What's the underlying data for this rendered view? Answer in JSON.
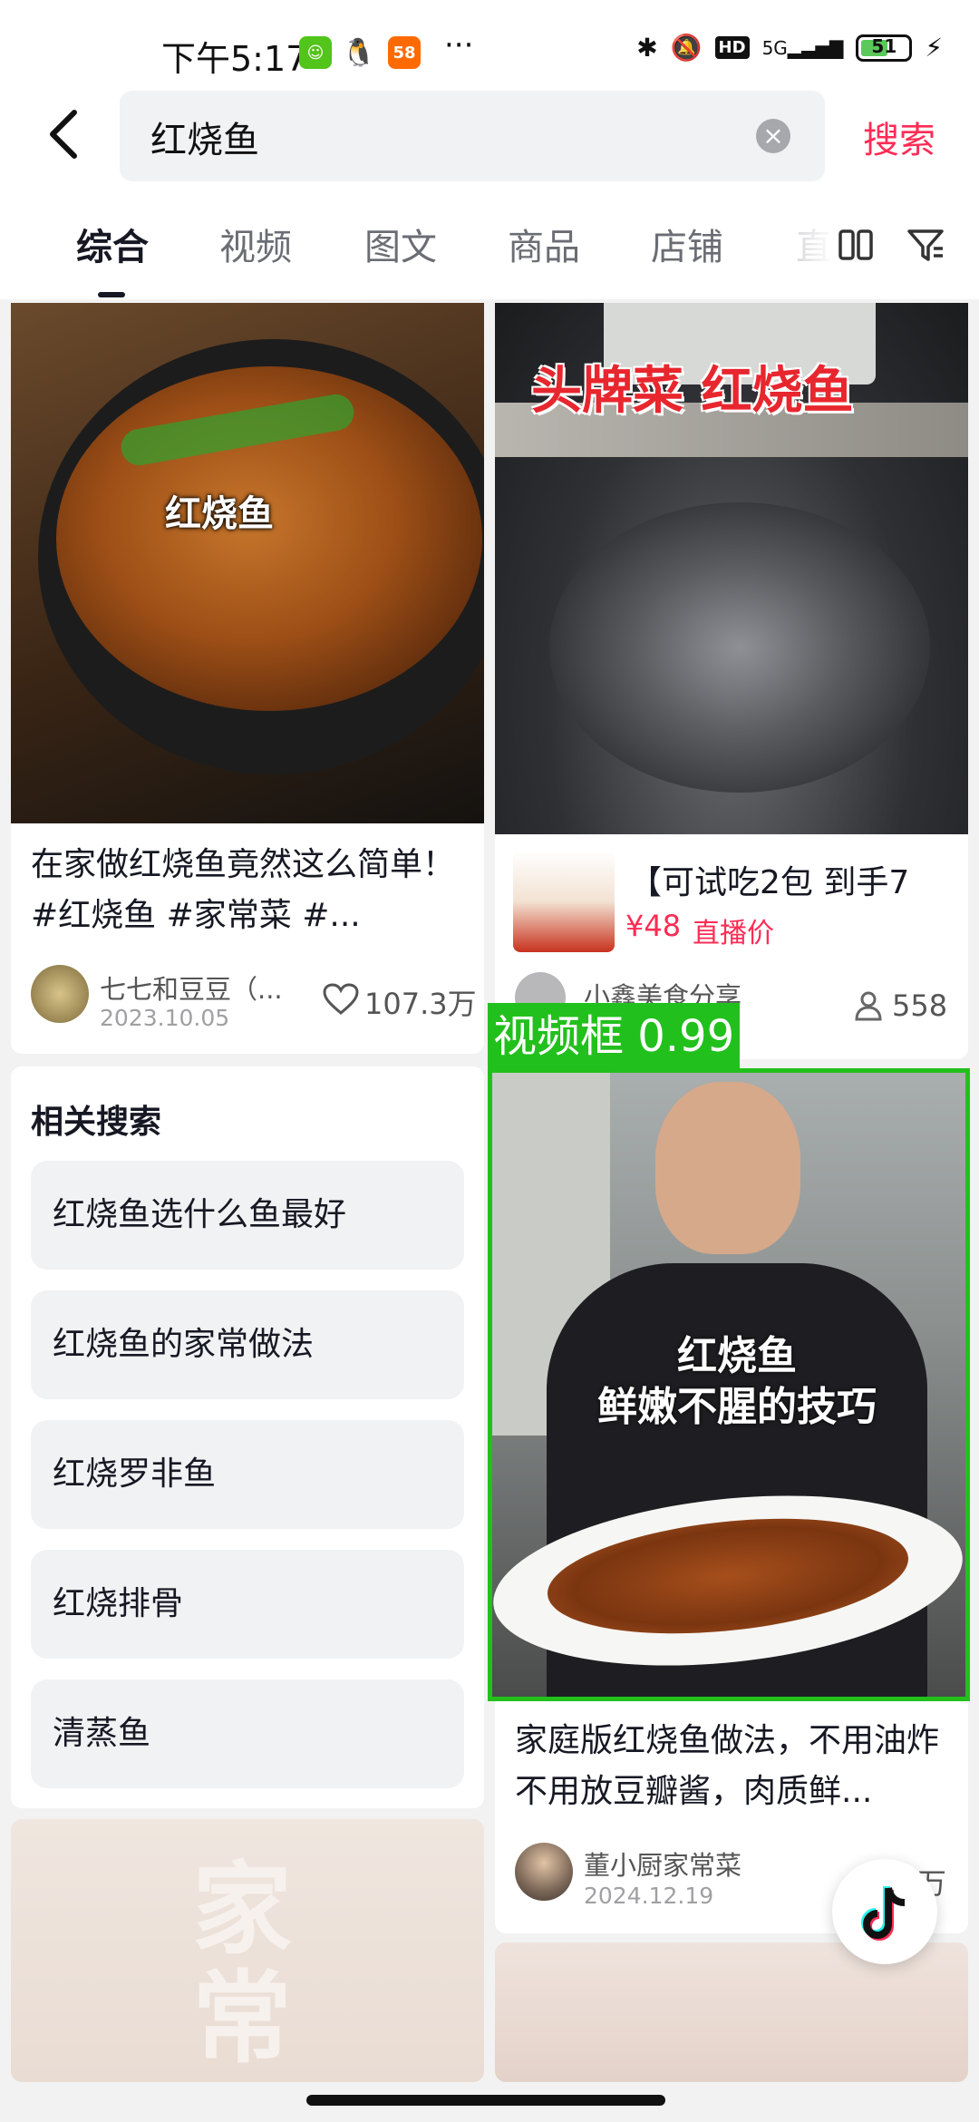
{
  "status_bar": {
    "time": "下午5:17",
    "network": "5G",
    "hd": "HD",
    "battery": "51",
    "app_badge_58": "58"
  },
  "search": {
    "query": "红烧鱼",
    "button_label": "搜索"
  },
  "tabs": [
    {
      "label": "综合",
      "active": true
    },
    {
      "label": "视频",
      "active": false
    },
    {
      "label": "图文",
      "active": false
    },
    {
      "label": "商品",
      "active": false
    },
    {
      "label": "店铺",
      "active": false
    },
    {
      "label": "直",
      "active": false
    }
  ],
  "left_card": {
    "thumb_caption": "红烧鱼",
    "title": "在家做红烧鱼竟然这么简单！#红烧鱼 #家常菜 #...",
    "author": "七七和豆豆（...",
    "date": "2023.10.05",
    "likes": "107.3万"
  },
  "related": {
    "heading": "相关搜索",
    "items": [
      "红烧鱼选什么鱼最好",
      "红烧鱼的家常做法",
      "红烧罗非鱼",
      "红烧排骨",
      "清蒸鱼"
    ]
  },
  "right_top_card": {
    "thumb_caption": "头牌菜 红烧鱼",
    "product_title": "【可试吃2包 到手7",
    "price": "¥48",
    "price_tag": "直播价",
    "author": "小鑫美食分享",
    "viewers": "558"
  },
  "detection": {
    "label": "视频框 0.99"
  },
  "right_video_card": {
    "thumb_caption_line1": "红烧鱼",
    "thumb_caption_line2": "鲜嫩不腥的技巧",
    "title": "家庭版红烧鱼做法，不用油炸不用放豆瓣酱，肉质鲜...",
    "author": "董小厨家常菜",
    "date": "2024.12.19",
    "likes": "万"
  },
  "colors": {
    "accent": "#fe2c55",
    "detection": "#22c01c"
  }
}
